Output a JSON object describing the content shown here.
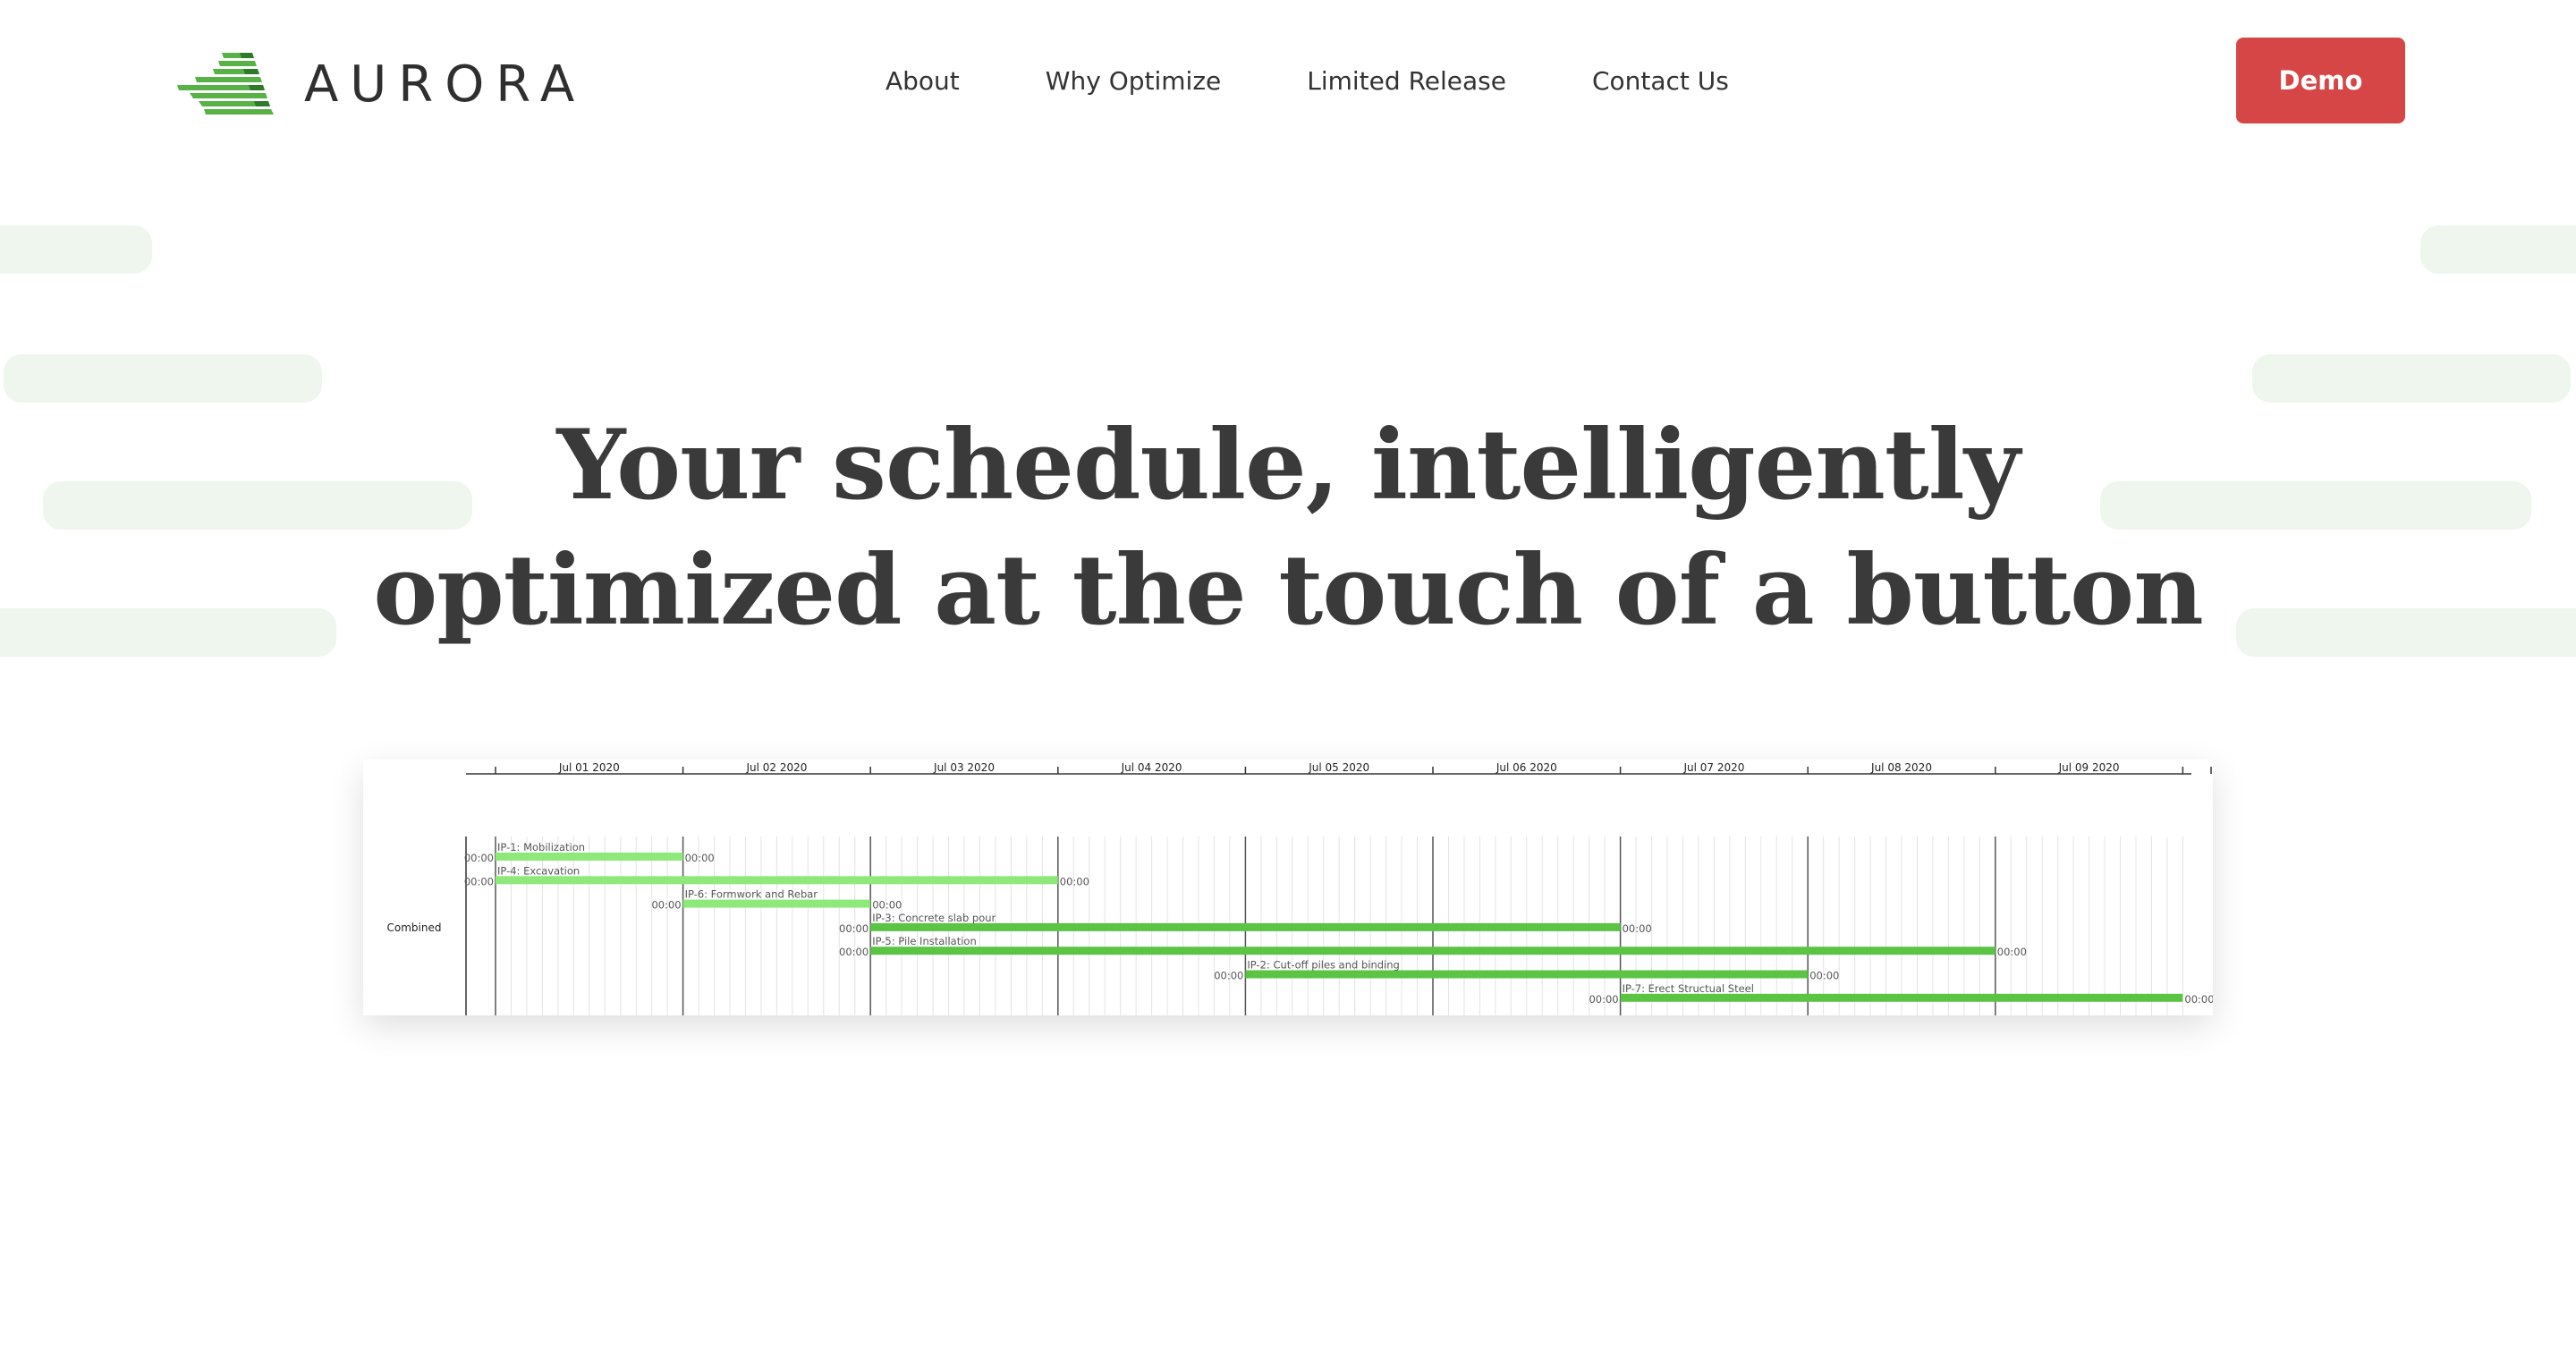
{
  "brand": {
    "name": "AURORA",
    "accent": "#58b147"
  },
  "nav": {
    "items": [
      {
        "label": "About"
      },
      {
        "label": "Why Optimize"
      },
      {
        "label": "Limited Release"
      },
      {
        "label": "Contact Us"
      }
    ],
    "cta_label": "Demo",
    "cta_color": "#d74646"
  },
  "hero": {
    "line1": "Your schedule, intelligently",
    "line2": "optimized at the touch of a button"
  },
  "chart_data": {
    "type": "gantt",
    "row_label": "Combined",
    "dates": [
      "Jul 01 2020",
      "Jul 02 2020",
      "Jul 03 2020",
      "Jul 04 2020",
      "Jul 05 2020",
      "Jul 06 2020",
      "Jul 07 2020",
      "Jul 08 2020",
      "Jul 09 2020"
    ],
    "time_label": "00:00",
    "tasks": [
      {
        "label": "IP-1: Mobilization",
        "start": 0.0,
        "end": 1.0,
        "color": "#8ee87a"
      },
      {
        "label": "IP-4: Excavation",
        "start": 0.0,
        "end": 3.0,
        "color": "#8ee87a"
      },
      {
        "label": "IP-6: Formwork and Rebar",
        "start": 1.0,
        "end": 2.0,
        "color": "#8ee87a"
      },
      {
        "label": "IP-3: Concrete slab pour",
        "start": 2.0,
        "end": 6.0,
        "color": "#5bc444"
      },
      {
        "label": "IP-5: Pile Installation",
        "start": 2.0,
        "end": 8.0,
        "color": "#5bc444"
      },
      {
        "label": "IP-2: Cut-off piles and binding",
        "start": 4.0,
        "end": 7.0,
        "color": "#5bc444"
      },
      {
        "label": "IP-7: Erect Structual Steel",
        "start": 6.0,
        "end": 9.0,
        "color": "#5bc444"
      }
    ]
  }
}
